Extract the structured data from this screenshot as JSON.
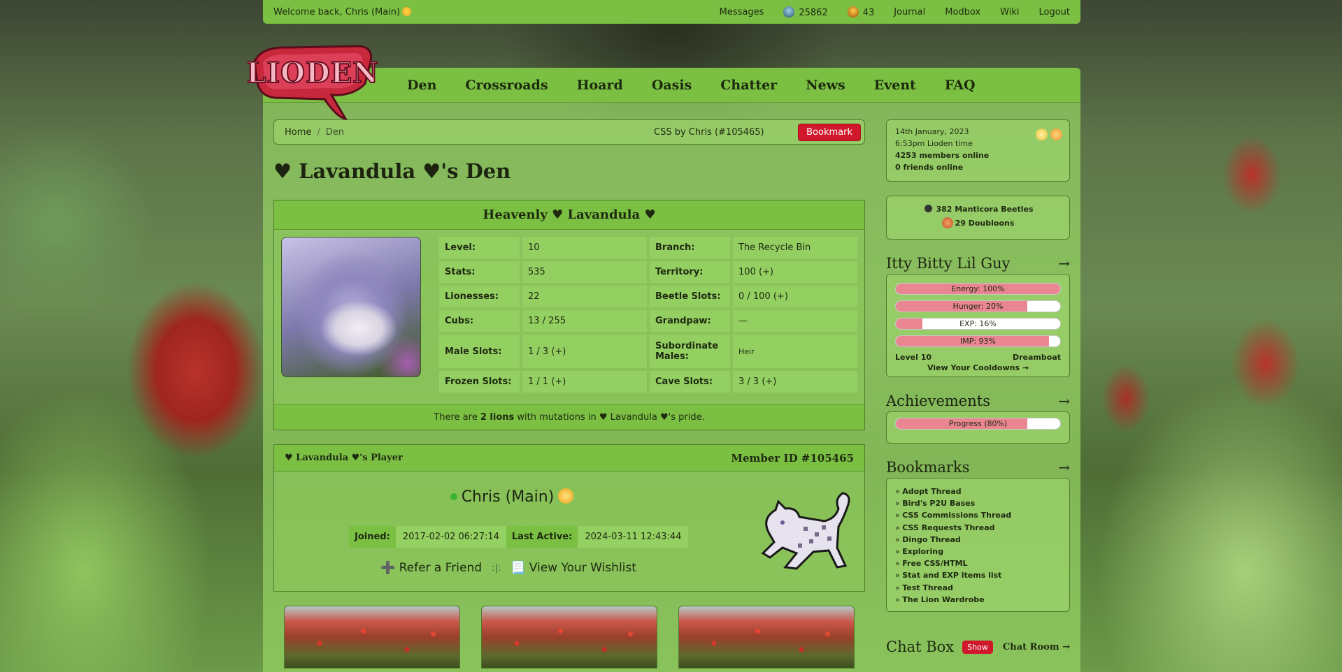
{
  "topbar": {
    "welcome_prefix": "Welcome back,",
    "user": "Chris (Main)",
    "messages": "Messages",
    "beetles": "25862",
    "golden_beetles": "43",
    "journal": "Journal",
    "modbox": "Modbox",
    "wiki": "Wiki",
    "logout": "Logout"
  },
  "logo_text": "LIODEN",
  "nav": [
    "Den",
    "Crossroads",
    "Hoard",
    "Oasis",
    "Chatter",
    "News",
    "Event",
    "FAQ"
  ],
  "breadcrumb": {
    "home": "Home",
    "separator": "/",
    "current": "Den",
    "css_by": "CSS by Chris (#105465)",
    "bookmark": "Bookmark"
  },
  "den_title": "♥ Lavandula ♥'s Den",
  "lion": {
    "name": "Heavenly ♥ Lavandula ♥",
    "stats": [
      {
        "k": "Level:",
        "v": "10",
        "k2": "Branch:",
        "v2": "The Recycle Bin"
      },
      {
        "k": "Stats:",
        "v": "535",
        "k2": "Territory:",
        "v2": "100 (+)"
      },
      {
        "k": "Lionesses:",
        "v": "22",
        "k2": "Beetle Slots:",
        "v2": "0 / 100 (+)"
      },
      {
        "k": "Cubs:",
        "v": "13 / 255",
        "k2": "Grandpaw:",
        "v2": "—"
      },
      {
        "k": "Male Slots:",
        "v": "1 / 3 (+)",
        "k2": "Subordinate Males:",
        "v2": "Heir"
      },
      {
        "k": "Frozen Slots:",
        "v": "1 / 1 (+)",
        "k2": "Cave Slots:",
        "v2": "3 / 3 (+)"
      }
    ],
    "mutation_pre": "There are",
    "mutation_count": "2 lions",
    "mutation_post": "with mutations in ♥ Lavandula ♥'s pride."
  },
  "player": {
    "header_left": "♥ Lavandula ♥'s Player",
    "member_id": "Member ID #105465",
    "name": "Chris (Main)",
    "joined_label": "Joined:",
    "joined": "2017-02-02 06:27:14",
    "active_label": "Last Active:",
    "active": "2024-03-11 12:43:44",
    "refer": "➕ Refer a Friend",
    "sep": ":|:",
    "wishlist": "📃 View Your Wishlist"
  },
  "side": {
    "date": "14th January, 2023",
    "time": "6:53pm Lioden time",
    "members": "4253 members online",
    "friends": "0 friends online",
    "beetles": "382 Manticora Beetles",
    "doubloons": "29 Doubloons",
    "guy_title": "Itty Bitty Lil Guy",
    "bars": [
      {
        "label": "Energy: 100%",
        "pct": 100
      },
      {
        "label": "Hunger: 20%",
        "pct": 80
      },
      {
        "label": "EXP: 16%",
        "pct": 16
      },
      {
        "label": "IMP: 93%",
        "pct": 93
      }
    ],
    "level": "Level 10",
    "title": "Dreamboat",
    "cooldowns": "View Your Cooldowns →",
    "ach_title": "Achievements",
    "ach_bar": {
      "label": "Progress (80%)",
      "pct": 80
    },
    "bm_title": "Bookmarks",
    "bookmarks": [
      "Adopt Thread",
      "Bird's P2U Bases",
      "CSS Commissions Thread",
      "CSS Requests Thread",
      "Dingo Thread",
      "Exploring",
      "Free CSS/HTML",
      "Stat and EXP items list",
      "Test Thread",
      "The Lion Wardrobe"
    ],
    "chat_title": "Chat Box",
    "show": "Show",
    "chat_room": "Chat Room →",
    "arrow": "→"
  }
}
